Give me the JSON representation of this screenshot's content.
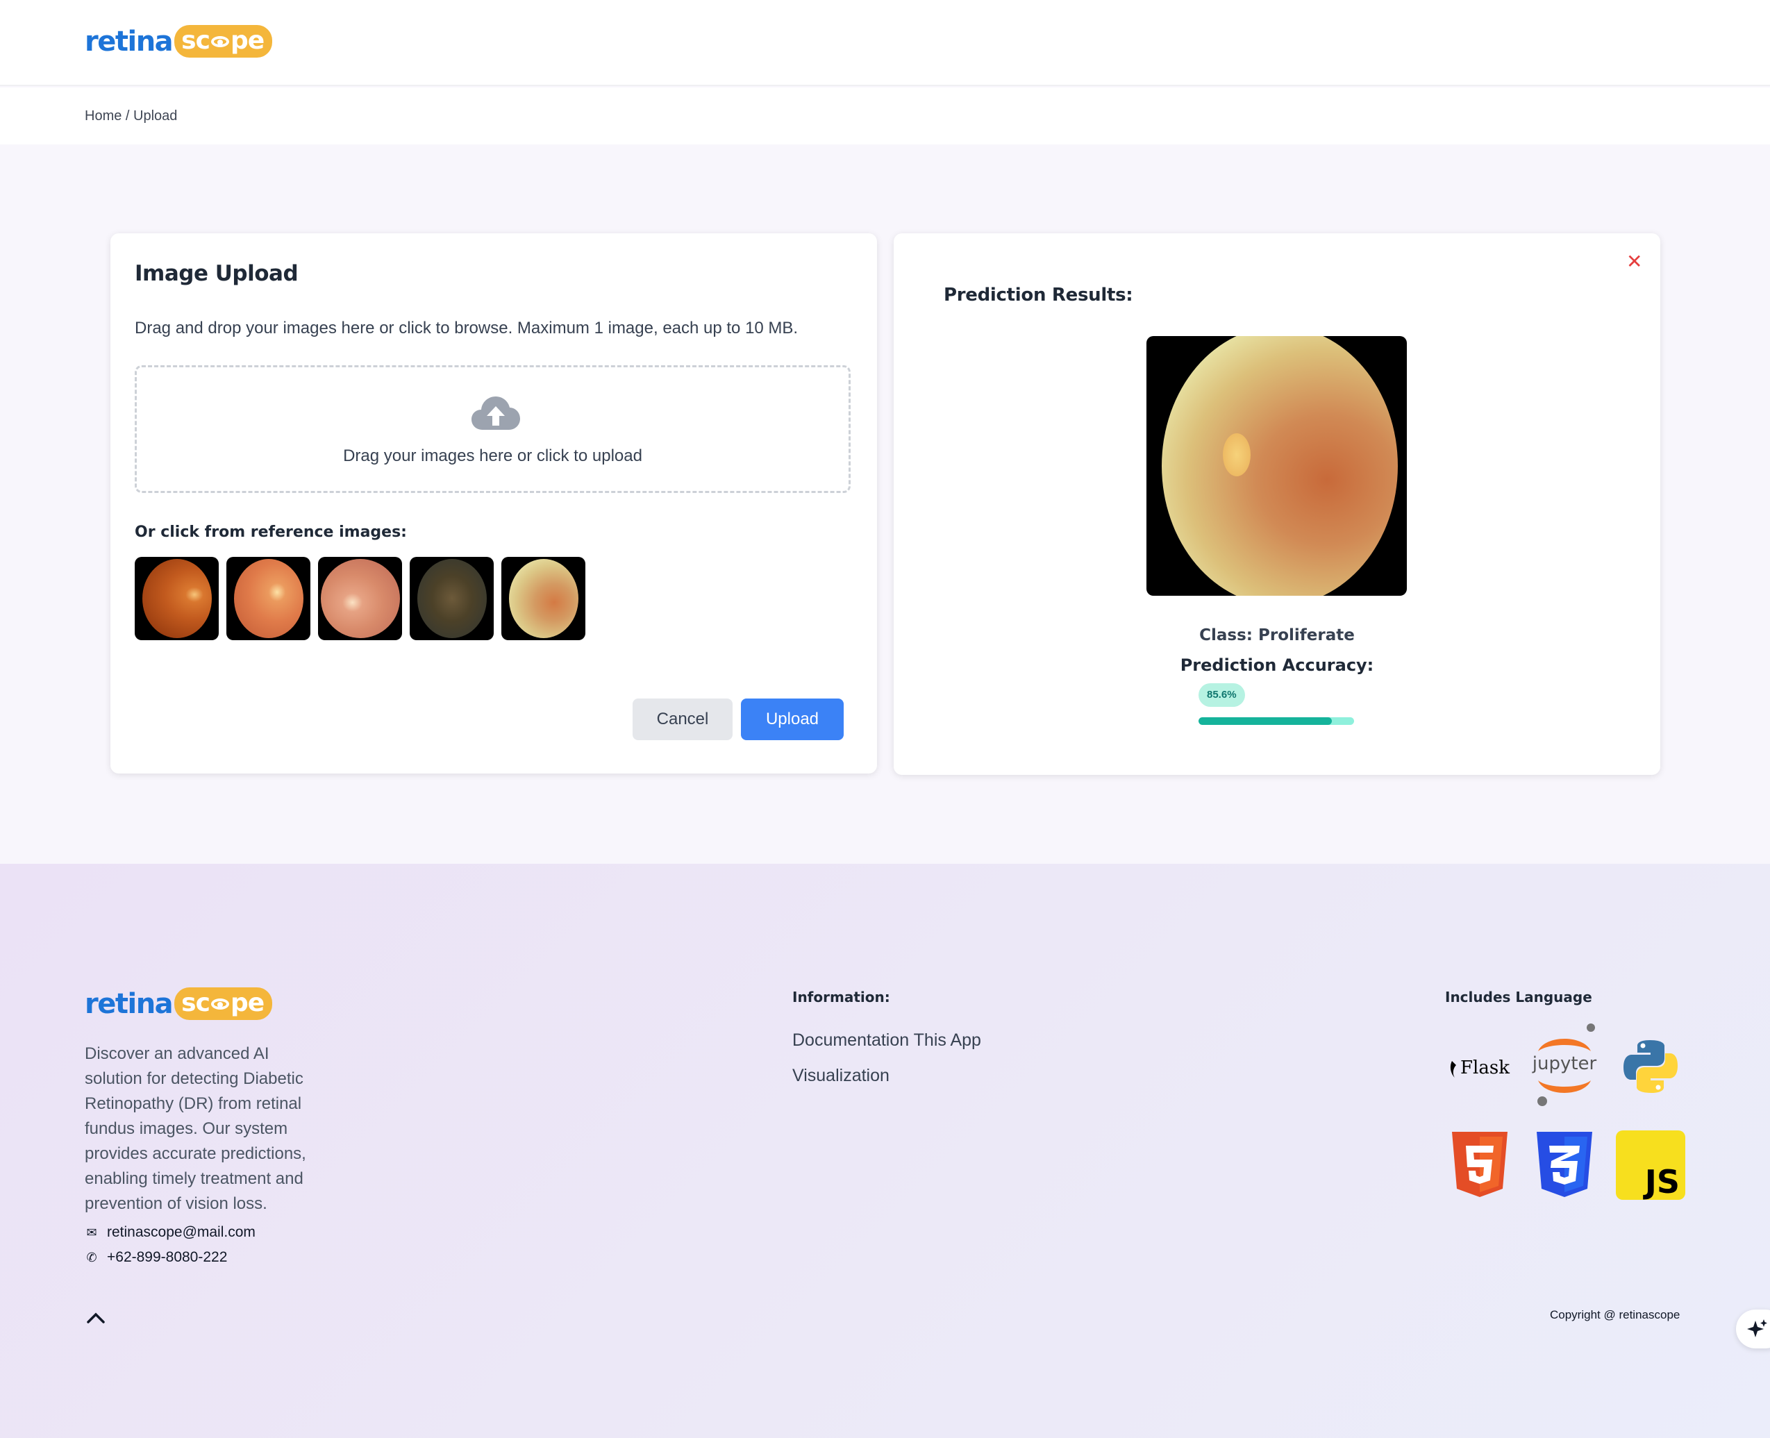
{
  "header": {
    "logo": {
      "part1": "retina",
      "part2a": "sc",
      "part2b": "pe"
    }
  },
  "breadcrumb": "Home / Upload",
  "upload": {
    "title": "Image Upload",
    "description": "Drag and drop your images here or click to browse. Maximum 1 image, each up to 10 MB.",
    "dropzone_text": "Drag your images here or click to upload",
    "reference_title": "Or click from reference images:",
    "cancel_label": "Cancel",
    "upload_label": "Upload"
  },
  "result": {
    "title": "Prediction Results:",
    "class_label": "Class: Proliferate",
    "accuracy_label": "Prediction Accuracy:",
    "accuracy_text": "85.6%",
    "accuracy_value": 85.6
  },
  "footer": {
    "about": "Discover an advanced AI solution for detecting Diabetic Retinopathy (DR) from retinal fundus images. Our system provides accurate predictions, enabling timely treatment and prevention of vision loss.",
    "email": "retinascope@mail.com",
    "phone": "+62-899-8080-222",
    "info_title": "Information:",
    "links": [
      "Documentation This App",
      "Visualization"
    ],
    "lang_title": "Includes Language",
    "tech": {
      "flask": "Flask",
      "jupyter": "jupyter",
      "js": "JS"
    },
    "copyright": "Copyright @ retinascope"
  },
  "colors": {
    "primary": "#3b82f6",
    "accent": "#f4b63b",
    "brand_blue": "#1d74d8",
    "success": "#15b39b",
    "danger": "#e53e3e"
  }
}
